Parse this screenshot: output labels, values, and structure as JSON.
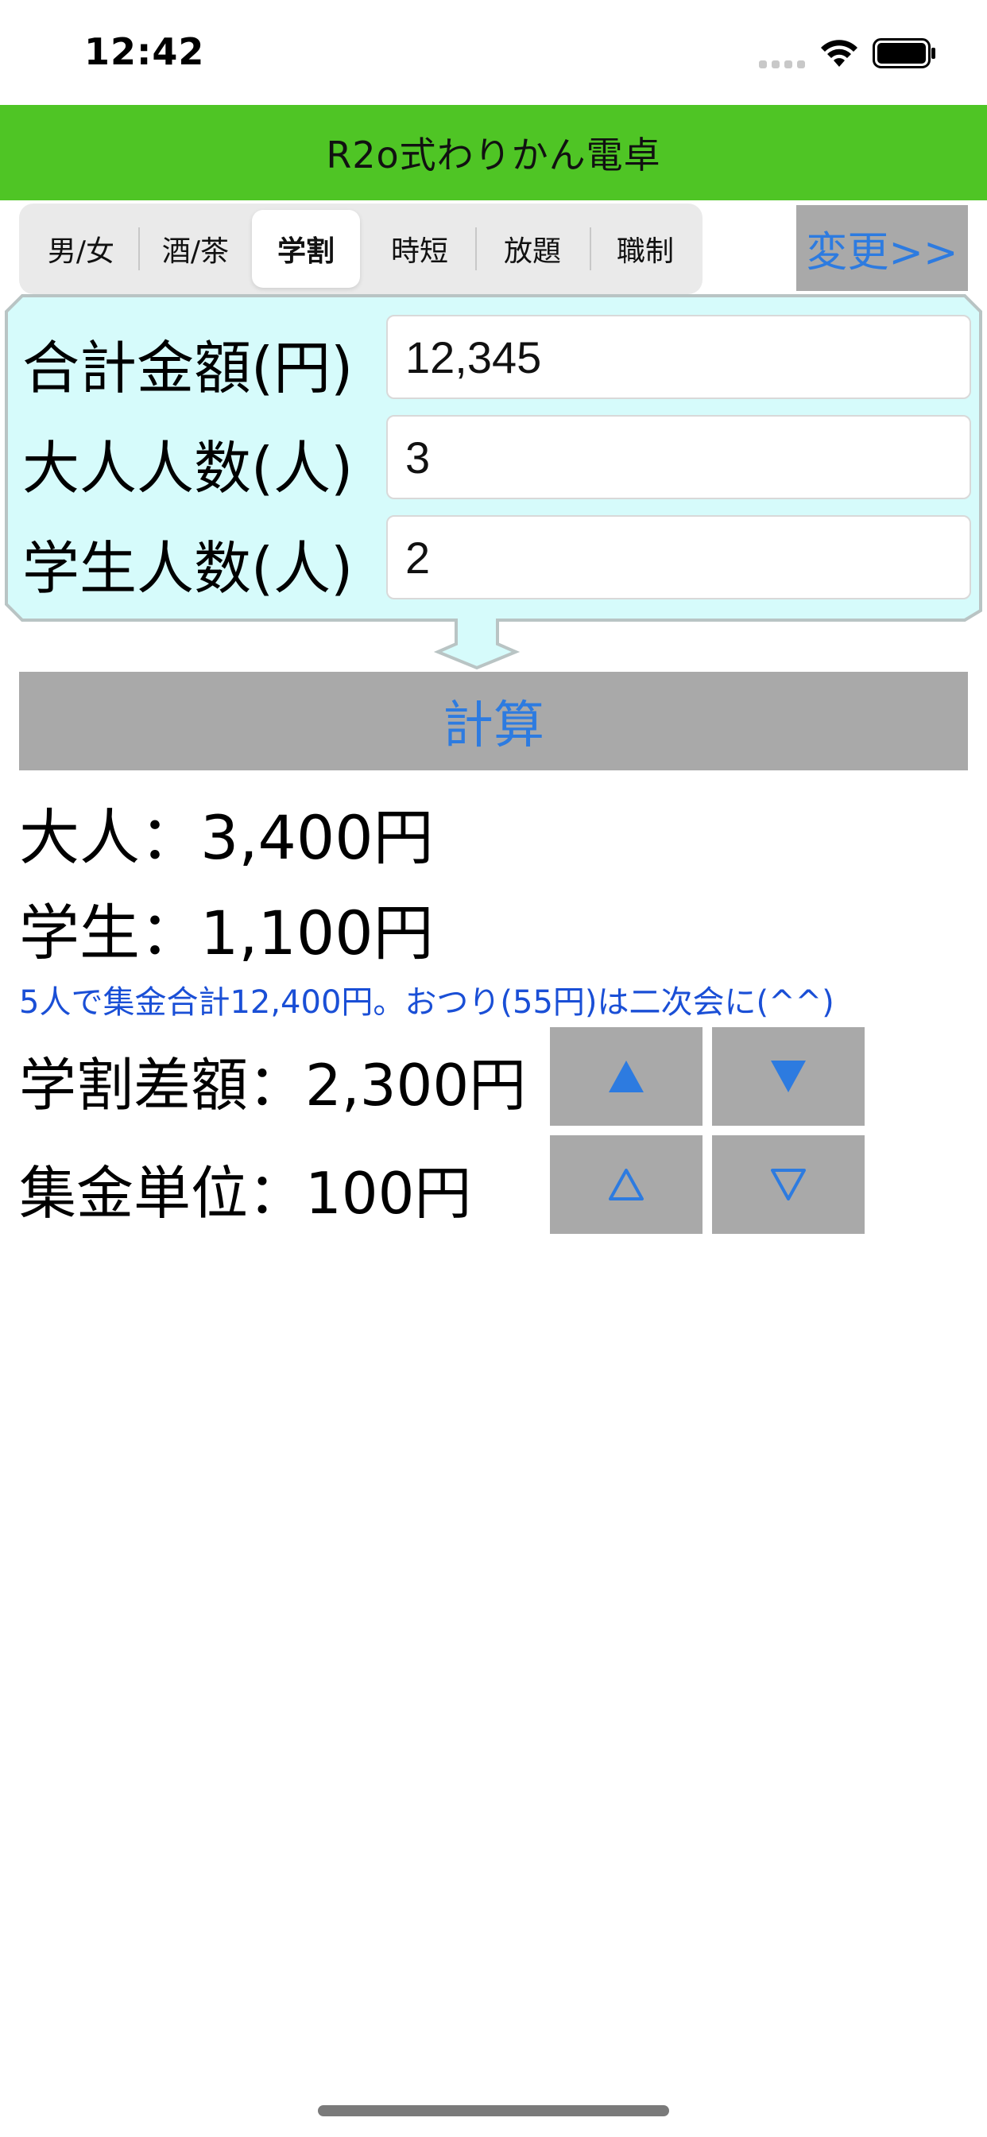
{
  "status_bar": {
    "time": "12:42",
    "icons": [
      "cellular-signal-icon",
      "wifi-icon",
      "battery-icon"
    ]
  },
  "app": {
    "title": "R2o式わりかん電卓"
  },
  "tabs": {
    "items": [
      {
        "label": "男/女",
        "selected": false
      },
      {
        "label": "酒/茶",
        "selected": false
      },
      {
        "label": "学割",
        "selected": true
      },
      {
        "label": "時短",
        "selected": false
      },
      {
        "label": "放題",
        "selected": false
      },
      {
        "label": "職制",
        "selected": false
      }
    ],
    "change_label": "変更>>"
  },
  "inputs": {
    "total_label": "合計金額(円)",
    "total_value": "12,345",
    "adults_label": "大人人数(人)",
    "adults_value": "3",
    "students_label": "学生人数(人)",
    "students_value": "2"
  },
  "calculate_label": "計算",
  "results": {
    "adult_line": "大人：3,400円",
    "student_line": "学生：1,100円",
    "note": "5人で集金合計12,400円。おつり(55円)は二次会に(^^)",
    "discount_line": "学割差額：2,300円",
    "unit_line": "集金単位：100円"
  },
  "arrows": {
    "discount_up": "▲",
    "discount_down": "▼",
    "unit_up": "△",
    "unit_down": "▽"
  },
  "colors": {
    "title_bar": "#4fc525",
    "button_bg": "#a9a9a9",
    "button_text": "#2d7be0",
    "panel_bg": "#d6fbfb",
    "note_text": "#1a4fd6"
  }
}
